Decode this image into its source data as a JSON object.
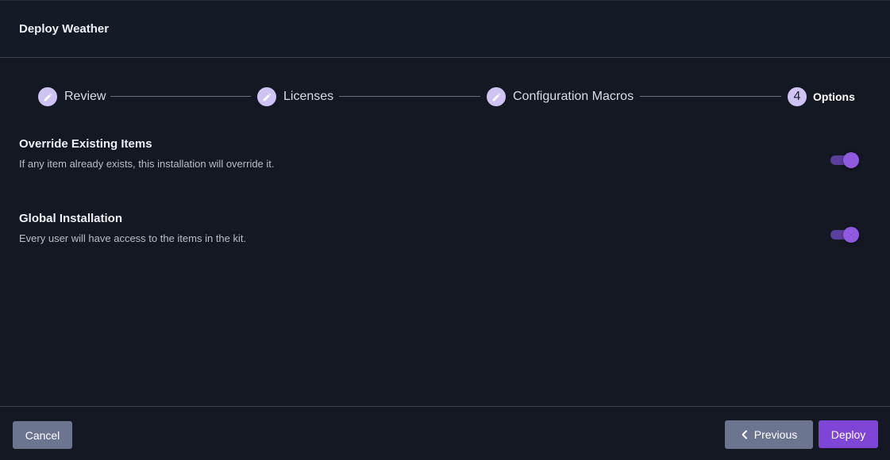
{
  "dialog": {
    "title": "Deploy Weather"
  },
  "stepper": {
    "steps": [
      {
        "label": "Review",
        "icon": "pencil-icon",
        "state": "completed"
      },
      {
        "label": "Licenses",
        "icon": "pencil-icon",
        "state": "completed"
      },
      {
        "label": "Configuration Macros",
        "icon": "pencil-icon",
        "state": "completed"
      },
      {
        "number": "4",
        "label": "Options",
        "state": "active"
      }
    ]
  },
  "options": [
    {
      "title": "Override Existing Items",
      "description": "If any item already exists, this installation will override it.",
      "enabled": true
    },
    {
      "title": "Global Installation",
      "description": "Every user will have access to the items in the kit.",
      "enabled": true
    }
  ],
  "footer": {
    "cancel_label": "Cancel",
    "previous_label": "Previous",
    "deploy_label": "Deploy"
  },
  "colors": {
    "background": "#131822",
    "accent": "#7f45d6",
    "secondary_button": "#6b7590",
    "step_circle": "#cfc3f3"
  }
}
